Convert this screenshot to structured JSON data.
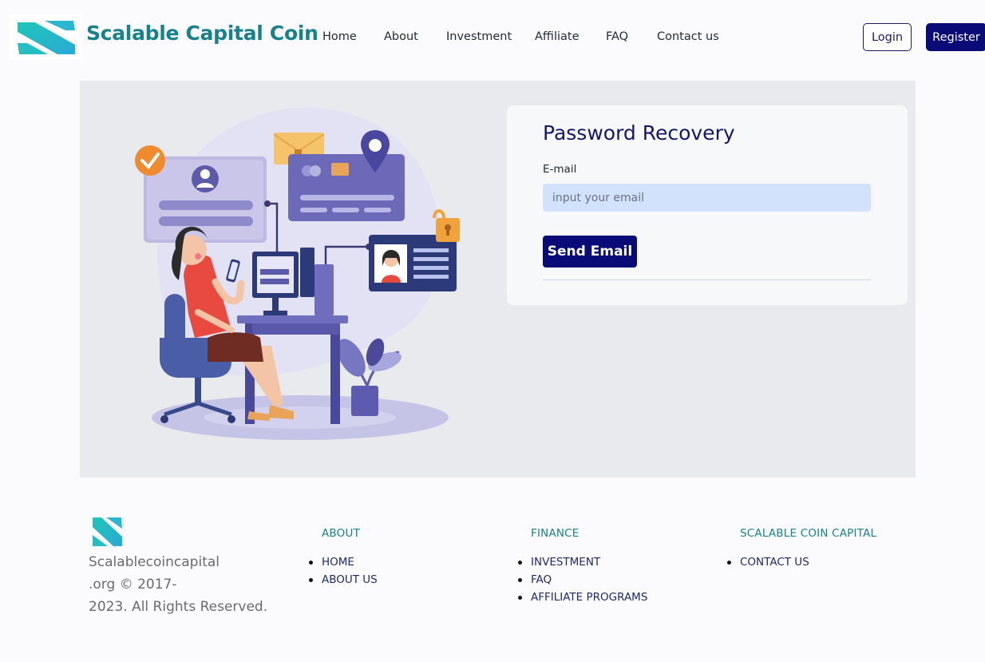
{
  "header": {
    "brand": "Scalable Capital Coin",
    "nav": [
      "Home",
      "About",
      "Investment",
      "Affiliate",
      "FAQ",
      "Contact us"
    ],
    "login_label": "Login",
    "register_label": "Register"
  },
  "recovery": {
    "title": "Password Recovery",
    "email_label": "E-mail",
    "email_placeholder": "input your email",
    "send_label": "Send Email"
  },
  "footer": {
    "copyright_lines": [
      "Scalablecoincapital",
      ".org © 2017-",
      "2023. All Rights Reserved."
    ],
    "columns": [
      {
        "title": "ABOUT",
        "links": [
          "HOME",
          "ABOUT US"
        ]
      },
      {
        "title": "FINANCE",
        "links": [
          "INVESTMENT",
          "FAQ",
          "AFFILIATE PROGRAMS"
        ]
      },
      {
        "title": "SCALABLE COIN CAPITAL",
        "links": [
          "CONTACT US"
        ]
      }
    ]
  },
  "icons": [
    "brand-logo-icon",
    "footer-logo-icon",
    "password-recovery-illustration"
  ],
  "colors": {
    "brand": "#17828a",
    "primary": "#0b0b78",
    "input_bg": "#d3e2fc",
    "hero_bg": "#e8eaed"
  }
}
